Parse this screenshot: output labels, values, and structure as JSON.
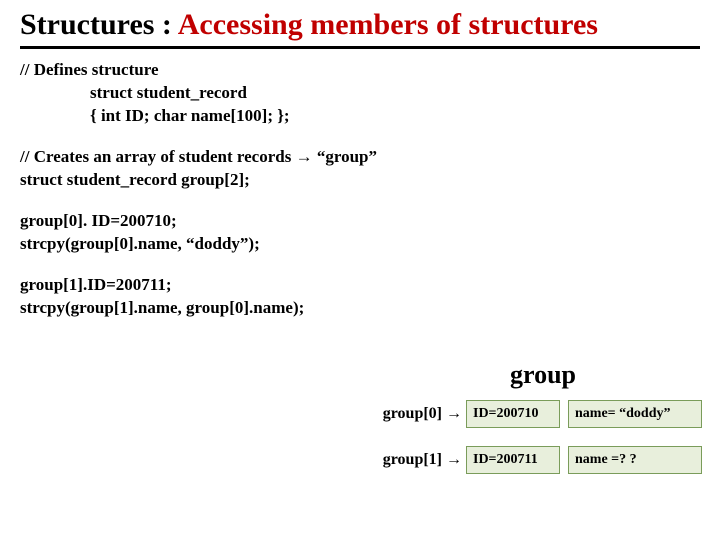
{
  "title": {
    "main": "Structures : ",
    "red": "Accessing members of structures"
  },
  "defines": {
    "comment": "// Defines structure",
    "line1": "struct student_record",
    "line2": "{  int ID;   char  name[100];   };"
  },
  "creates": {
    "comment": "// Creates an array of student records ",
    "comment_bold_arrow": "→",
    "comment_bold_tail": " “group”",
    "line1": "struct student_record group[2];"
  },
  "assign0": {
    "line1": "group[0]. ID=200710;",
    "line2": "strcpy(group[0].name, “doddy”);"
  },
  "assign1": {
    "line1": "group[1].ID=200711;",
    "line2": "strcpy(group[1].name, group[0].name);"
  },
  "table": {
    "title": "group",
    "rows": [
      {
        "label": "group[0] →",
        "id": "ID=200710",
        "name": "name= “doddy”"
      },
      {
        "label": "group[1] →",
        "id": "ID=200711",
        "name": "name =? ?"
      }
    ]
  }
}
